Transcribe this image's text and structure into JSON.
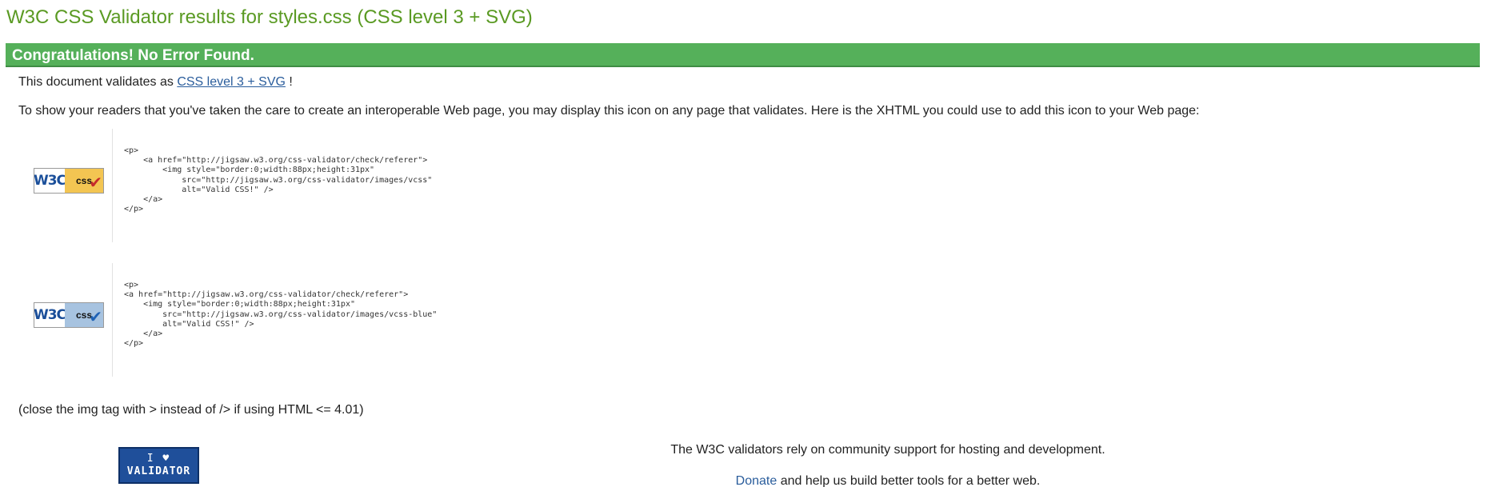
{
  "page": {
    "title": "W3C CSS Validator results for styles.css (CSS level 3 + SVG)"
  },
  "banner": {
    "text": "Congratulations! No Error Found."
  },
  "validates": {
    "prefix": "This document validates as ",
    "link": "CSS level 3 + SVG",
    "suffix": " !"
  },
  "info": {
    "text": "To show your readers that you've taken the care to create an interoperable Web page, you may display this icon on any page that validates. Here is the XHTML you could use to add this icon to your Web page:"
  },
  "badges": [
    {
      "w3c": "W3C",
      "css": "css",
      "icon": "check-icon",
      "code": "<p>\n    <a href=\"http://jigsaw.w3.org/css-validator/check/referer\">\n        <img style=\"border:0;width:88px;height:31px\"\n            src=\"http://jigsaw.w3.org/css-validator/images/vcss\"\n            alt=\"Valid CSS!\" />\n    </a>\n</p>"
    },
    {
      "w3c": "W3C",
      "css": "css",
      "icon": "check-icon",
      "code": "<p>\n<a href=\"http://jigsaw.w3.org/css-validator/check/referer\">\n    <img style=\"border:0;width:88px;height:31px\"\n        src=\"http://jigsaw.w3.org/css-validator/images/vcss-blue\"\n        alt=\"Valid CSS!\" />\n    </a>\n</p>"
    }
  ],
  "note": {
    "text": "(close the img tag with > instead of /> if using HTML <= 4.01)"
  },
  "love_badge": {
    "line1": "I ♥",
    "line2": "VALIDATOR"
  },
  "support": {
    "text": "The W3C validators rely on community support for hosting and development.",
    "donate_link": "Donate",
    "donate_suffix": " and help us build better tools for a better web."
  },
  "colors": {
    "title": "#5a9a23",
    "banner": "#55b05a",
    "link": "#2a5d9c"
  }
}
